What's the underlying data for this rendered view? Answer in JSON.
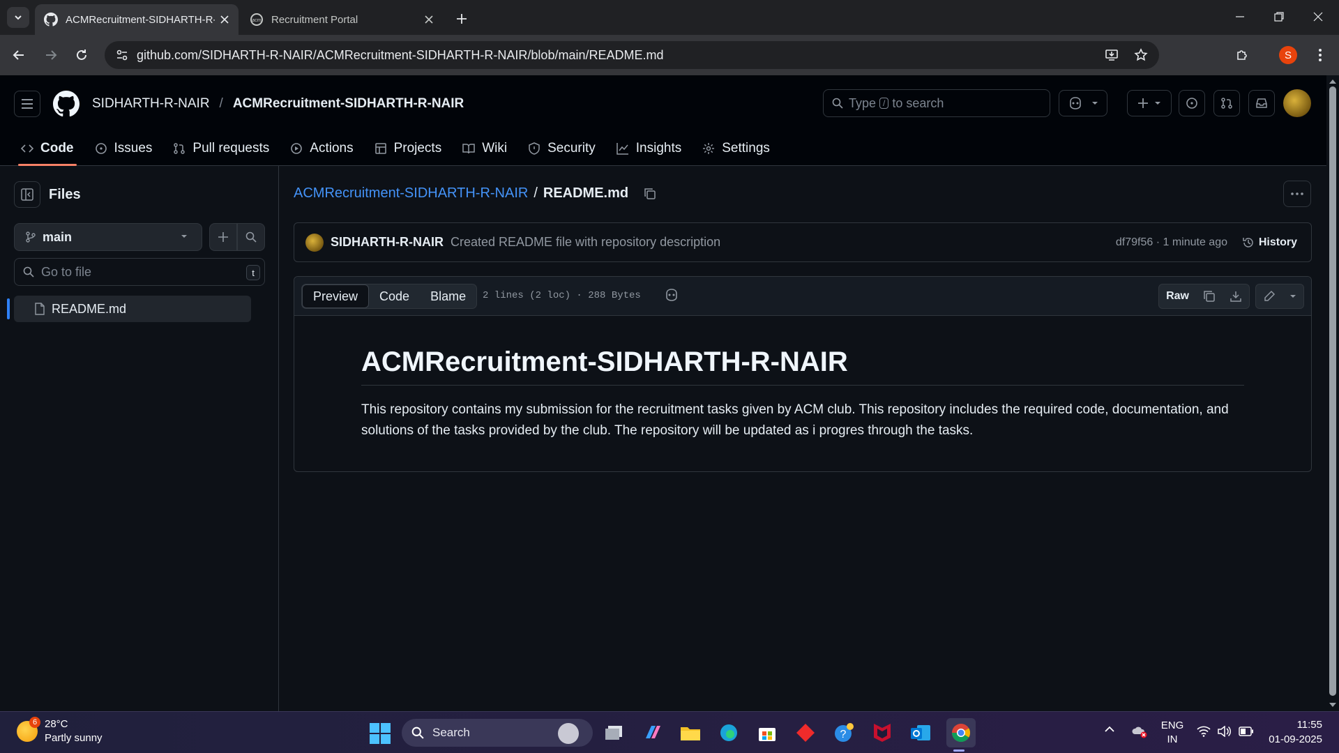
{
  "browser": {
    "tabs": [
      {
        "title": "ACMRecruitment-SIDHARTH-R-",
        "active": true
      },
      {
        "title": "Recruitment Portal",
        "active": false
      }
    ],
    "url": "github.com/SIDHARTH-R-NAIR/ACMRecruitment-SIDHARTH-R-NAIR/blob/main/README.md",
    "profile_initial": "S"
  },
  "header": {
    "owner": "SIDHARTH-R-NAIR",
    "separator": "/",
    "repo": "ACMRecruitment-SIDHARTH-R-NAIR",
    "search": {
      "pre": "Type",
      "key": "/",
      "post": "to search"
    }
  },
  "repo_nav": [
    {
      "label": "Code",
      "icon": "code-icon",
      "selected": true
    },
    {
      "label": "Issues",
      "icon": "issue-icon"
    },
    {
      "label": "Pull requests",
      "icon": "pull-request-icon"
    },
    {
      "label": "Actions",
      "icon": "play-icon"
    },
    {
      "label": "Projects",
      "icon": "table-icon"
    },
    {
      "label": "Wiki",
      "icon": "book-icon"
    },
    {
      "label": "Security",
      "icon": "shield-icon"
    },
    {
      "label": "Insights",
      "icon": "graph-icon"
    },
    {
      "label": "Settings",
      "icon": "gear-icon"
    }
  ],
  "sidebar": {
    "title": "Files",
    "branch": "main",
    "goto_placeholder": "Go to file",
    "goto_key": "t",
    "files": [
      "README.md"
    ]
  },
  "file": {
    "repo_link": "ACMRecruitment-SIDHARTH-R-NAIR",
    "slash": "/",
    "name": "README.md"
  },
  "commit": {
    "author": "SIDHARTH-R-NAIR",
    "message": "Created README file with repository description",
    "meta": "df79f56 · 1 minute ago",
    "history_label": "History"
  },
  "viewer": {
    "tabs": [
      "Preview",
      "Code",
      "Blame"
    ],
    "selected_tab": "Preview",
    "stats": "2 lines (2 loc) · 288 Bytes",
    "raw_label": "Raw"
  },
  "readme": {
    "heading": "ACMRecruitment-SIDHARTH-R-NAIR",
    "paragraph": "This repository contains my submission for the recruitment tasks given by ACM club. This repository includes the required code, documentation, and solutions of the tasks provided by the club. The repository will be updated as i progres through the tasks."
  },
  "taskbar": {
    "weather_temp": "28°C",
    "weather_desc": "Partly sunny",
    "weather_badge": "6",
    "search_label": "Search",
    "lang_line1": "ENG",
    "lang_line2": "IN",
    "time": "11:55",
    "date": "01-09-2025"
  },
  "colors": {
    "accent_link": "#4493f8",
    "selected_tab_underline": "#f78166",
    "page_bg": "#0d1117"
  }
}
